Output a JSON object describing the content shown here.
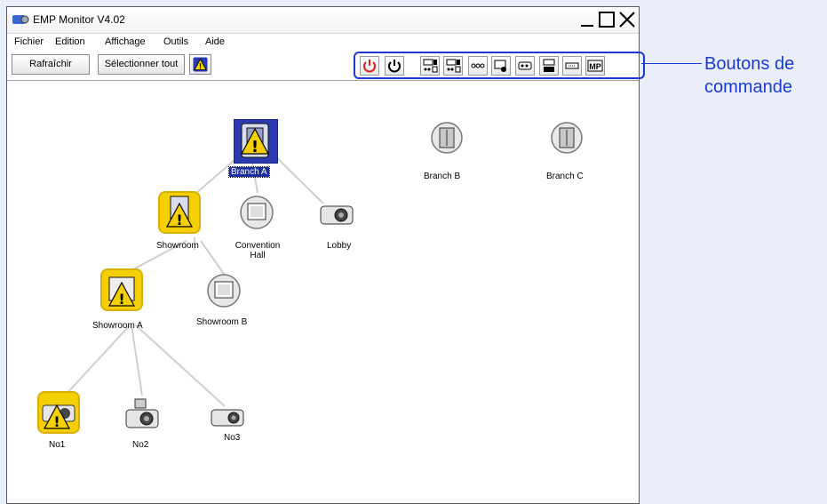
{
  "window": {
    "title": "EMP Monitor V4.02"
  },
  "menu": {
    "items": [
      "Fichier",
      "Edition",
      "Affichage",
      "Outils",
      "Aide"
    ]
  },
  "toolbar": {
    "refresh_label": "Rafraîchir",
    "select_all_label": "Sélectionner tout"
  },
  "command_buttons": [
    {
      "name": "power-on-icon"
    },
    {
      "name": "power-off-icon"
    },
    {
      "name": "computer1-icon"
    },
    {
      "name": "computer2-icon"
    },
    {
      "name": "video-icon"
    },
    {
      "name": "s-video-icon"
    },
    {
      "name": "easymp-icon"
    },
    {
      "name": "av-mute-icon"
    },
    {
      "name": "input-source-icon"
    },
    {
      "name": "mp-icon"
    }
  ],
  "callout": {
    "line1": "Boutons de",
    "line2": "commande"
  },
  "nodes": {
    "branch_a": "Branch A",
    "branch_b": "Branch B",
    "branch_c": "Branch C",
    "showroom": "Showroom",
    "convention_hall_1": "Convention",
    "convention_hall_2": "Hall",
    "lobby": "Lobby",
    "showroom_a": "Showroom A",
    "showroom_b": "Showroom B",
    "no1": "No1",
    "no2": "No2",
    "no3": "No3"
  },
  "colors": {
    "accent": "#1a3ad0",
    "warning": "#f5d000",
    "selected": "#1a2d9a"
  }
}
